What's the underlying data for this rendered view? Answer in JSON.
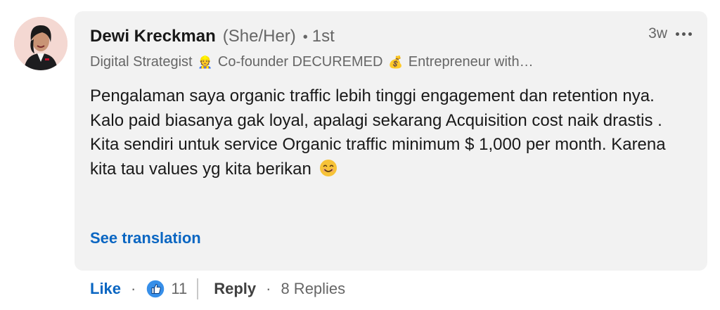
{
  "author": {
    "name": "Dewi Kreckman",
    "pronouns": "(She/Her)",
    "separator": "•",
    "degree": "1st",
    "headline_parts": [
      "Digital Strategist",
      "Co-founder DECUREMED",
      "Entrepreneur with…"
    ],
    "headline_icons": [
      "office-worker-emoji",
      "money-bag-emoji"
    ]
  },
  "meta": {
    "time": "3w",
    "more_icon": "ellipsis-icon"
  },
  "comment": {
    "text": "Pengalaman saya organic traffic lebih tinggi engagement dan retention nya. Kalo paid biasanya gak loyal, apalagi sekarang Acquisition cost naik drastis . Kita sendiri untuk service Organic traffic minimum $ 1,000 per month. Karena kita tau values yg kita berikan",
    "trailing_emoji": "smiling-face-emoji"
  },
  "see_translation": "See translation",
  "actions": {
    "like_label": "Like",
    "dot": "·",
    "reaction_icon": "thumbs-up-icon",
    "like_count": "11",
    "reply_label": "Reply",
    "replies_label": "8 Replies"
  },
  "colors": {
    "accent": "#0a66c2",
    "bubble_bg": "#f2f2f2",
    "muted_text": "#666666",
    "primary_text": "#191919"
  }
}
